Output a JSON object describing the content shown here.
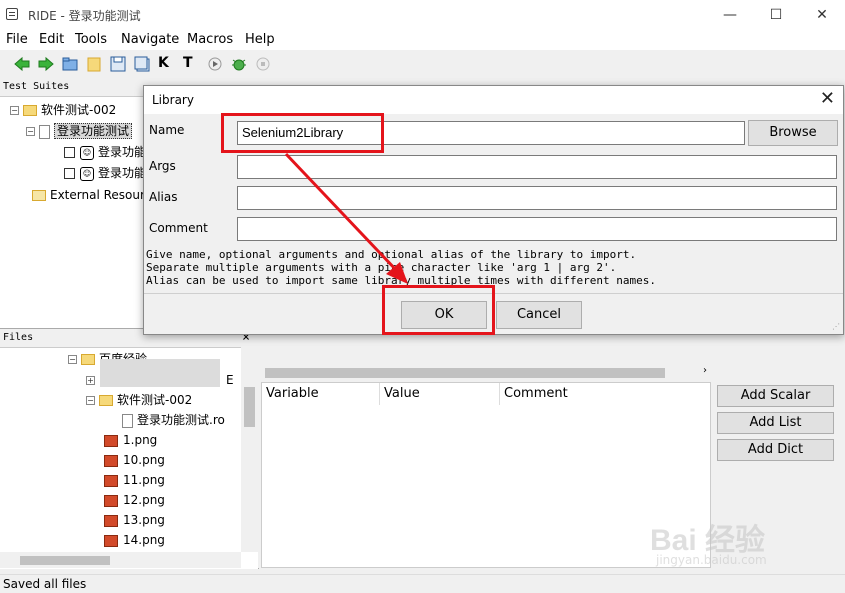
{
  "window": {
    "title": "RIDE - 登录功能测试",
    "controls": [
      "—",
      "☐",
      "✕"
    ]
  },
  "menu": [
    "File",
    "Edit",
    "Tools",
    "Navigate",
    "Macros",
    "Help"
  ],
  "toolbar": {
    "k_label": "K",
    "t_label": "T"
  },
  "suites_pane": {
    "header": "Test Suites",
    "items": [
      "软件测试-002",
      "登录功能测试",
      "登录功能",
      "登录功能",
      "External Resour"
    ]
  },
  "files_pane": {
    "header": "Files",
    "close": "×",
    "items": [
      "百度经验",
      "E",
      "软件测试-002",
      "登录功能测试.ro",
      "1.png",
      "10.png",
      "11.png",
      "12.png",
      "13.png",
      "14.png"
    ]
  },
  "variables_grid": {
    "columns": [
      "Variable",
      "Value",
      "Comment"
    ]
  },
  "side_buttons": [
    "Add Scalar",
    "Add List",
    "Add Dict"
  ],
  "status": "Saved all files",
  "dialog": {
    "title": "Library",
    "close": "✕",
    "fields": {
      "name_label": "Name",
      "name_value": "Selenium2Library",
      "args_label": "Args",
      "args_value": "",
      "alias_label": "Alias",
      "alias_value": "",
      "comment_label": "Comment",
      "comment_value": ""
    },
    "browse": "Browse",
    "help_lines": [
      "Give name, optional arguments and optional alias of the library to import.",
      "Separate multiple arguments with a pipe character like 'arg 1 | arg 2'.",
      "Alias can be used to import same library multiple times with different names."
    ],
    "ok": "OK",
    "cancel": "Cancel"
  },
  "watermark": {
    "brand": "Bai 经验",
    "url": "jingyan.baidu.com"
  },
  "colors": {
    "annotation_red": "#e4141b",
    "folder": "#f6d97a",
    "png_icon": "#d24a2a"
  }
}
